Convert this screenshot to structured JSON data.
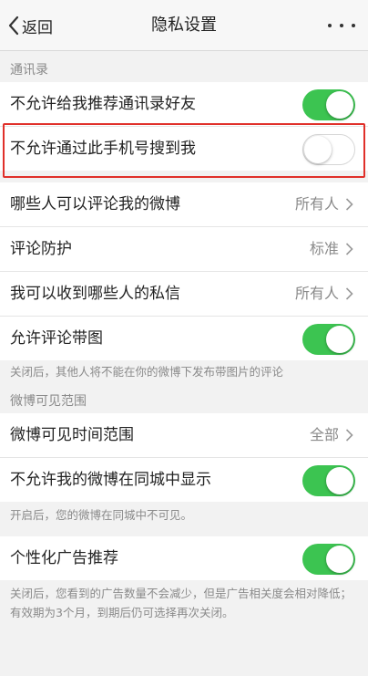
{
  "nav": {
    "back_label": "返回",
    "title": "隐私设置"
  },
  "sections": {
    "contacts_header": "通讯录",
    "weibo_visible_header": "微博可见范围"
  },
  "rows": {
    "no_recommend_contacts": {
      "label": "不允许给我推荐通讯录好友",
      "toggle": "on"
    },
    "no_find_by_phone": {
      "label": "不允许通过此手机号搜到我",
      "toggle": "off"
    },
    "who_can_comment": {
      "label": "哪些人可以评论我的微博",
      "value": "所有人"
    },
    "comment_protection": {
      "label": "评论防护",
      "value": "标准"
    },
    "who_can_message": {
      "label": "我可以收到哪些人的私信",
      "value": "所有人"
    },
    "allow_comment_images": {
      "label": "允许评论带图",
      "toggle": "on"
    },
    "weibo_visible_time": {
      "label": "微博可见时间范围",
      "value": "全部"
    },
    "no_show_same_city": {
      "label": "不允许我的微博在同城中显示",
      "toggle": "on"
    },
    "personalized_ads": {
      "label": "个性化广告推荐",
      "toggle": "on"
    }
  },
  "notes": {
    "comment_images_note": "关闭后，其他人将不能在你的微博下发布带图片的评论",
    "same_city_note": "开启后，您的微博在同城中不可见。",
    "ads_note": "关闭后，您看到的广告数量不会减少，但是广告相关度会相对降低；有效期为3个月，到期后仍可选择再次关闭。"
  },
  "colors": {
    "toggle_on": "#3cc451",
    "highlight": "#e0302a"
  }
}
